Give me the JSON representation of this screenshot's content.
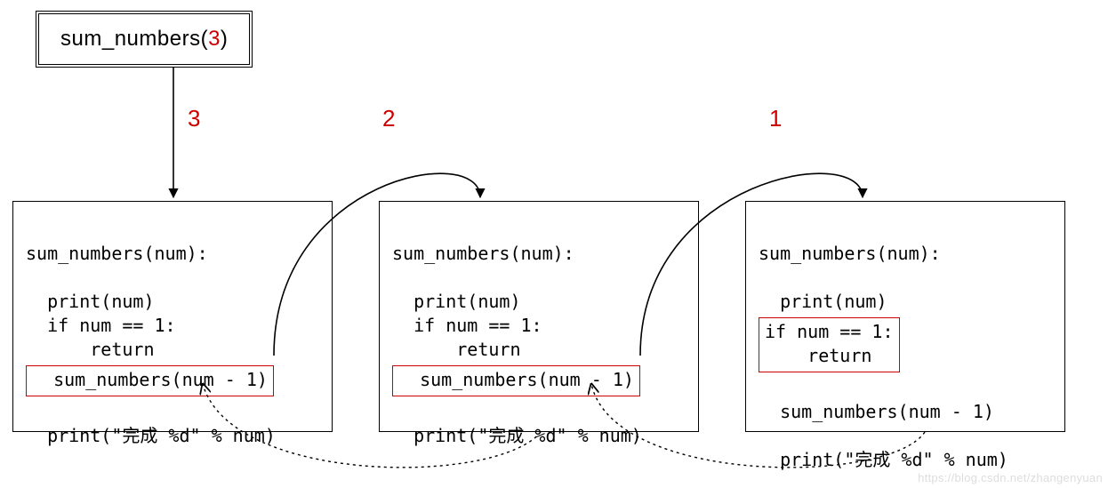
{
  "call": {
    "fn": "sum_numbers",
    "arg": "3"
  },
  "steps": {
    "s3": "3",
    "s2": "2",
    "s1": "1"
  },
  "code": {
    "def": "sum_numbers(num):",
    "print": "print(num)",
    "cond": "if num == 1:",
    "ret": "    return",
    "rec": "sum_numbers(num - 1)",
    "done": "print(\"完成 %d\" % num)"
  },
  "watermark": "https://blog.csdn.net/zhangenyuan"
}
